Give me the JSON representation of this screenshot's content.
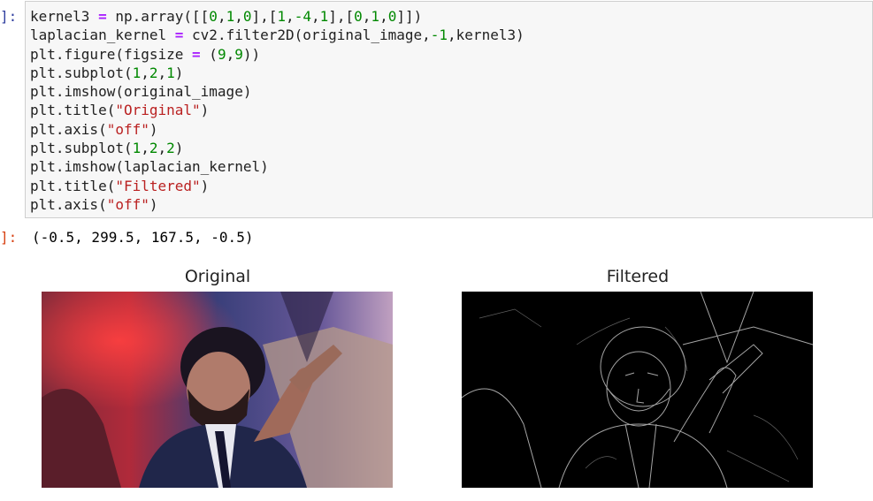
{
  "cell": {
    "input_prompt": "]:",
    "output_prompt": "]:",
    "code_lines": [
      [
        {
          "t": "kernel3 "
        },
        {
          "t": "=",
          "c": "op"
        },
        {
          "t": " np.array([["
        },
        {
          "t": "0",
          "c": "num"
        },
        {
          "t": ","
        },
        {
          "t": "1",
          "c": "num"
        },
        {
          "t": ","
        },
        {
          "t": "0",
          "c": "num"
        },
        {
          "t": "],["
        },
        {
          "t": "1",
          "c": "num"
        },
        {
          "t": ","
        },
        {
          "t": "-4",
          "c": "num"
        },
        {
          "t": ","
        },
        {
          "t": "1",
          "c": "num"
        },
        {
          "t": "],["
        },
        {
          "t": "0",
          "c": "num"
        },
        {
          "t": ","
        },
        {
          "t": "1",
          "c": "num"
        },
        {
          "t": ","
        },
        {
          "t": "0",
          "c": "num"
        },
        {
          "t": "]])"
        }
      ],
      [
        {
          "t": "laplacian_kernel "
        },
        {
          "t": "=",
          "c": "op"
        },
        {
          "t": " cv2.filter2D(original_image,"
        },
        {
          "t": "-1",
          "c": "num"
        },
        {
          "t": ",kernel3)"
        }
      ],
      [
        {
          "t": "plt.figure(figsize "
        },
        {
          "t": "=",
          "c": "op"
        },
        {
          "t": " ("
        },
        {
          "t": "9",
          "c": "num"
        },
        {
          "t": ","
        },
        {
          "t": "9",
          "c": "num"
        },
        {
          "t": "))"
        }
      ],
      [
        {
          "t": "plt.subplot("
        },
        {
          "t": "1",
          "c": "num"
        },
        {
          "t": ","
        },
        {
          "t": "2",
          "c": "num"
        },
        {
          "t": ","
        },
        {
          "t": "1",
          "c": "num"
        },
        {
          "t": ")"
        }
      ],
      [
        {
          "t": "plt.imshow(original_image)"
        }
      ],
      [
        {
          "t": "plt.title("
        },
        {
          "t": "\"Original\"",
          "c": "str"
        },
        {
          "t": ")"
        }
      ],
      [
        {
          "t": "plt.axis("
        },
        {
          "t": "\"off\"",
          "c": "str"
        },
        {
          "t": ")"
        }
      ],
      [
        {
          "t": "plt.subplot("
        },
        {
          "t": "1",
          "c": "num"
        },
        {
          "t": ","
        },
        {
          "t": "2",
          "c": "num"
        },
        {
          "t": ","
        },
        {
          "t": "2",
          "c": "num"
        },
        {
          "t": ")"
        }
      ],
      [
        {
          "t": "plt.imshow(laplacian_kernel)"
        }
      ],
      [
        {
          "t": "plt.title("
        },
        {
          "t": "\"Filtered\"",
          "c": "str"
        },
        {
          "t": ")"
        }
      ],
      [
        {
          "t": "plt.axis("
        },
        {
          "t": "\"off\"",
          "c": "str"
        },
        {
          "t": ")"
        }
      ]
    ],
    "output_text": "(-0.5, 299.5, 167.5, -0.5)"
  },
  "figure": {
    "left_title": "Original",
    "right_title": "Filtered"
  },
  "colors": {
    "prompt": "#303f9f",
    "keyword_op": "#aa22ff",
    "number": "#008800",
    "string": "#ba2121"
  }
}
